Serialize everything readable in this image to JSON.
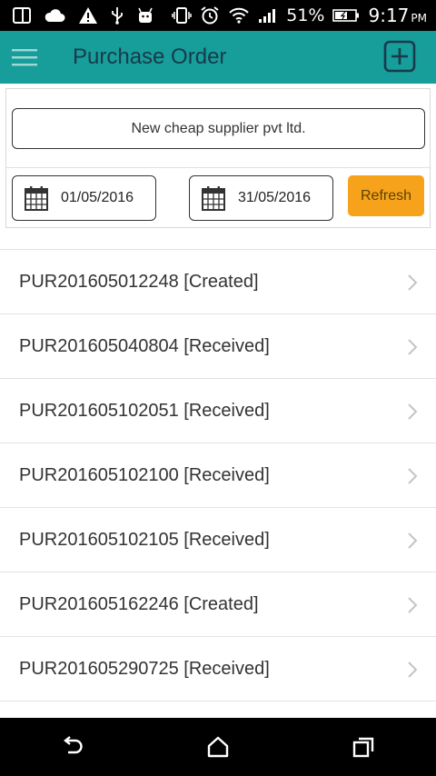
{
  "status_bar": {
    "battery_percent": "51%",
    "time": "9:17",
    "ampm": "PM"
  },
  "app_bar": {
    "title": "Purchase Order"
  },
  "filter": {
    "supplier": "New cheap supplier pvt ltd.",
    "date_from": "01/05/2016",
    "date_to": "31/05/2016",
    "refresh_label": "Refresh"
  },
  "orders": [
    {
      "label": "PUR201605012248 [Created]"
    },
    {
      "label": "PUR201605040804 [Received]"
    },
    {
      "label": "PUR201605102051 [Received]"
    },
    {
      "label": "PUR201605102100 [Received]"
    },
    {
      "label": "PUR201605102105 [Received]"
    },
    {
      "label": "PUR201605162246 [Created]"
    },
    {
      "label": "PUR201605290725 [Received]"
    }
  ],
  "colors": {
    "app_bar": "#179d9a",
    "title_text": "#173b4a",
    "refresh_button": "#f7a21b"
  },
  "icons": [
    "notification-square-icon",
    "cloud-icon",
    "warning-icon",
    "usb-icon",
    "android-icon",
    "vibrate-icon",
    "alarm-icon",
    "wifi-icon",
    "signal-icon",
    "battery-icon",
    "menu-icon",
    "add-icon",
    "calendar-icon",
    "chevron-right-icon",
    "back-icon",
    "home-icon",
    "recents-icon"
  ]
}
